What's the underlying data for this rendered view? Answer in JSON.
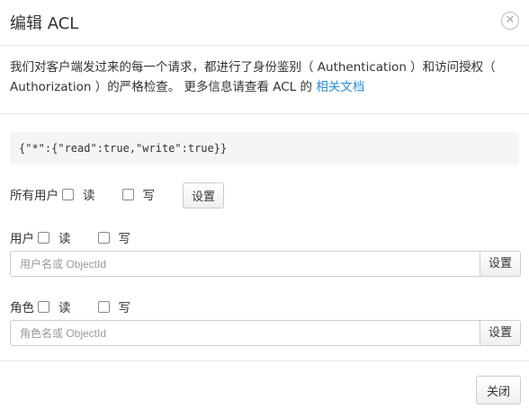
{
  "dialog": {
    "title": "编辑 ACL",
    "close_icon": "close-icon"
  },
  "description": {
    "text": "我们对客户端发过来的每一个请求，都进行了身份鉴别（ Authentication ）和访问授权（ Authorization ）的严格检查。 更多信息请查看 ACL 的 ",
    "link_label": "相关文档"
  },
  "acl_json": "{\"*\":{\"read\":true,\"write\":true}}",
  "all_users": {
    "label": "所有用户",
    "read_label": "读",
    "write_label": "写",
    "set_button": "设置",
    "read_checked": false,
    "write_checked": false
  },
  "users": {
    "label": "用户",
    "read_label": "读",
    "write_label": "写",
    "placeholder": "用户名或 ObjectId",
    "set_button": "设置"
  },
  "roles": {
    "label": "角色",
    "read_label": "读",
    "write_label": "写",
    "placeholder": "角色名或 ObjectId",
    "set_button": "设置"
  },
  "footer": {
    "close_button": "关闭"
  }
}
